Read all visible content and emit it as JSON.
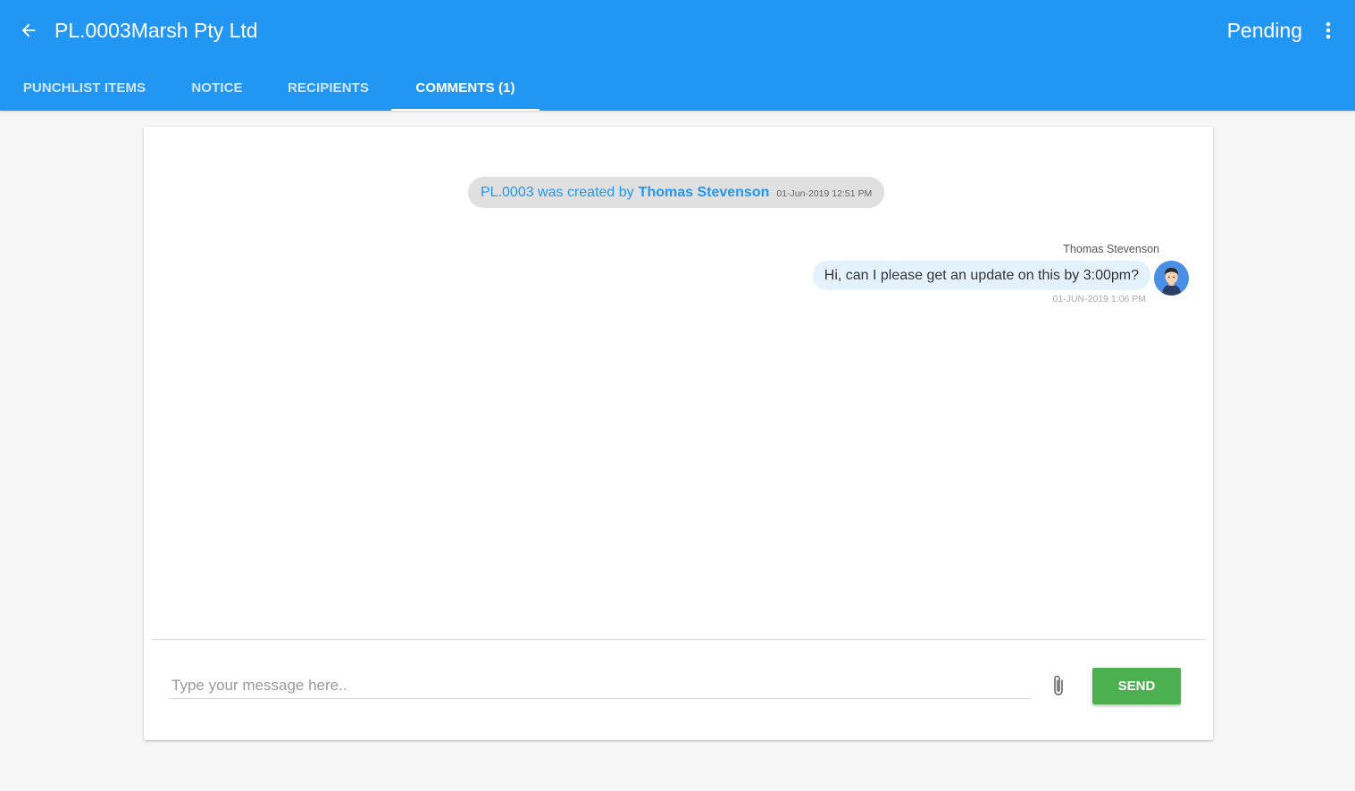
{
  "header": {
    "title": "PL.0003Marsh Pty Ltd",
    "status": "Pending",
    "back_icon": "arrow-left-icon",
    "menu_icon": "more-vertical-icon",
    "color": "#2196f3"
  },
  "tabs": [
    {
      "label": "PUNCHLIST ITEMS",
      "active": false
    },
    {
      "label": "NOTICE",
      "active": false
    },
    {
      "label": "RECIPIENTS",
      "active": false
    },
    {
      "label": "COMMENTS (1)",
      "active": true
    }
  ],
  "comments": {
    "system_message": {
      "text": "PL.0003 was created by",
      "author": "Thomas Stevenson",
      "timestamp": "01-Jun-2019 12:51 PM"
    },
    "messages": [
      {
        "sender": "Thomas Stevenson",
        "text": "Hi, can I please get an update on this by 3:00pm?",
        "timestamp": "01-JUN-2019 1:06 PM",
        "avatar_icon": "user-avatar-icon"
      }
    ],
    "composer": {
      "placeholder": "Type your message here..",
      "value": "",
      "attach_icon": "paperclip-icon",
      "send_label": "SEND",
      "send_color": "#4caf50"
    }
  }
}
